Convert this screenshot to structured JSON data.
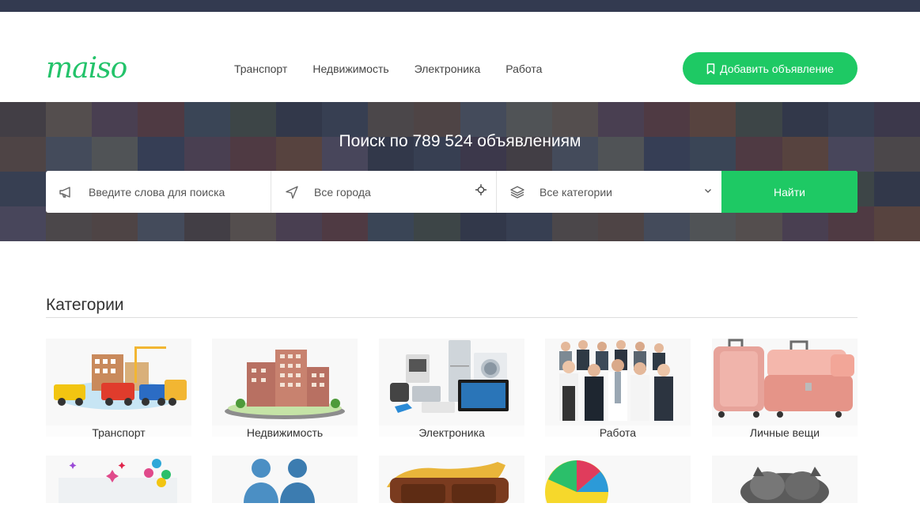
{
  "brand": {
    "logo_text": "maiso",
    "accent_color": "#1ec964",
    "topbar_color": "#333a50"
  },
  "nav": {
    "items": [
      {
        "label": "Транспорт"
      },
      {
        "label": "Недвижимость"
      },
      {
        "label": "Электроника"
      },
      {
        "label": "Работа"
      }
    ]
  },
  "header": {
    "add_button_label": "Добавить объявление",
    "add_button_icon": "bookmark-icon"
  },
  "hero": {
    "title": "Поиск по 789 524 объявлениям",
    "search": {
      "keywords_placeholder": "Введите слова для поиска",
      "keywords_icon": "megaphone-icon",
      "city_placeholder": "Все города",
      "city_icon": "navigation-arrow-icon",
      "city_locate_icon": "crosshair-icon",
      "category_value": "Все категории",
      "category_icon": "layers-icon",
      "category_dropdown_icon": "chevron-down-icon",
      "submit_label": "Найти"
    }
  },
  "categories": {
    "heading": "Категории",
    "items": [
      {
        "label": "Транспорт",
        "image": "vehicles-illustration"
      },
      {
        "label": "Недвижимость",
        "image": "building-illustration"
      },
      {
        "label": "Электроника",
        "image": "appliances-illustration"
      },
      {
        "label": "Работа",
        "image": "business-people-illustration"
      },
      {
        "label": "Личные вещи",
        "image": "suitcases-illustration"
      }
    ]
  }
}
